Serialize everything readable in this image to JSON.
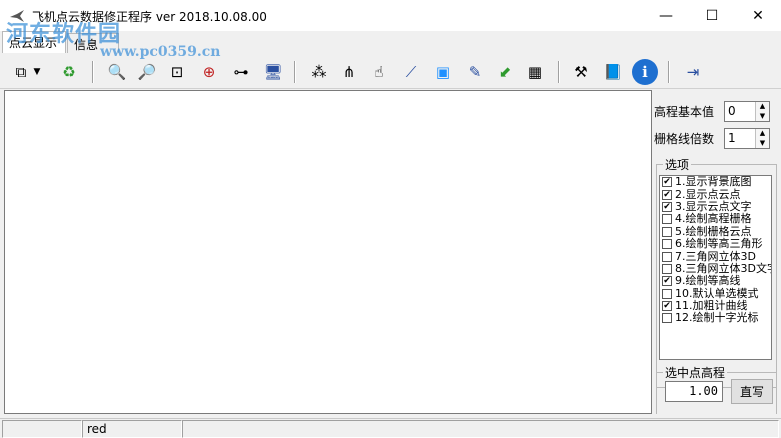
{
  "window": {
    "title": "飞机点云数据修正程序 ver 2018.10.08.00",
    "minimize_glyph": "—",
    "maximize_glyph": "☐",
    "close_glyph": "✕"
  },
  "watermark": {
    "text": "河东软件园",
    "url": "www.pc0359.cn"
  },
  "tabs": [
    {
      "label": "点云显示"
    },
    {
      "label": "信息"
    }
  ],
  "toolbar": {
    "buttons": [
      {
        "icon": "copy-icon",
        "glyph": "⧉"
      },
      {
        "icon": "dropdown-arrow-icon",
        "glyph": "▼"
      },
      {
        "icon": "recycle-icon",
        "glyph": "♻"
      },
      {
        "icon": "zoom-in-icon",
        "glyph": "🔍"
      },
      {
        "icon": "zoom-out-icon",
        "glyph": "🔎"
      },
      {
        "icon": "zoom-window-icon",
        "glyph": "⊡"
      },
      {
        "icon": "fit-icon",
        "glyph": "⊕"
      },
      {
        "icon": "tree-icon",
        "glyph": "⊶"
      },
      {
        "icon": "computer-icon",
        "glyph": "🖥"
      },
      {
        "icon": "network-icon",
        "glyph": "⁂"
      },
      {
        "icon": "hierarchy-icon",
        "glyph": "⋔"
      },
      {
        "icon": "hand-pan-icon",
        "glyph": "☝"
      },
      {
        "icon": "polyline-icon",
        "glyph": "⟋"
      },
      {
        "icon": "select-point-icon",
        "glyph": "▣"
      },
      {
        "icon": "edit-icon",
        "glyph": "✎"
      },
      {
        "icon": "export-arrow-icon",
        "glyph": "⬋"
      },
      {
        "icon": "calculator-icon",
        "glyph": "▦"
      },
      {
        "icon": "tools-icon",
        "glyph": "⚒"
      },
      {
        "icon": "book-icon",
        "glyph": "📘"
      },
      {
        "icon": "info-icon",
        "glyph": "ℹ"
      },
      {
        "icon": "exit-icon",
        "glyph": "⇥"
      }
    ],
    "accent": "#1e90ff"
  },
  "side": {
    "base_height_label": "高程基本值",
    "base_height_value": "0",
    "grid_multiple_label": "栅格线倍数",
    "grid_multiple_value": "1",
    "options_title": "选项",
    "options": [
      {
        "label": "1.显示背景底图",
        "checked": true
      },
      {
        "label": "2.显示点云点",
        "checked": true
      },
      {
        "label": "3.显示云点文字",
        "checked": true
      },
      {
        "label": "4.绘制高程栅格",
        "checked": false
      },
      {
        "label": "5.绘制栅格云点",
        "checked": false
      },
      {
        "label": "6.绘制等高三角形",
        "checked": false
      },
      {
        "label": "7.三角网立体3D",
        "checked": false
      },
      {
        "label": "8.三角网立体3D文字",
        "checked": false
      },
      {
        "label": "9.绘制等高线",
        "checked": true
      },
      {
        "label": "10.默认单选模式",
        "checked": false
      },
      {
        "label": "11.加粗计曲线",
        "checked": true
      },
      {
        "label": "12.绘制十字光标",
        "checked": false
      }
    ],
    "point_height_title": "选中点高程",
    "point_height_value": "1.00",
    "point_height_button": "直写"
  },
  "status": {
    "pane1": "",
    "pane2": "red",
    "pane3": ""
  }
}
